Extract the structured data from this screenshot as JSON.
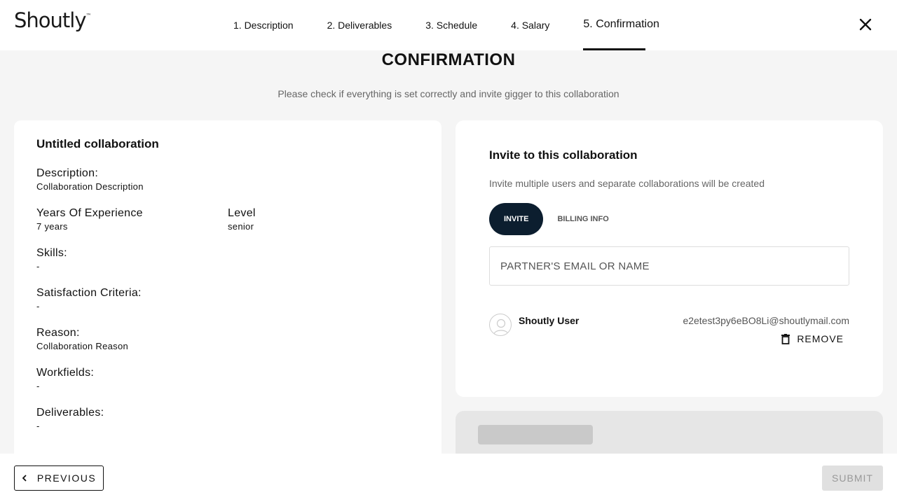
{
  "app": {
    "logo": "Shoutly"
  },
  "steps": [
    {
      "label": "1. Description"
    },
    {
      "label": "2. Deliverables"
    },
    {
      "label": "3. Schedule"
    },
    {
      "label": "4. Salary"
    },
    {
      "label": "5. Confirmation",
      "active": true
    }
  ],
  "page": {
    "title": "CONFIRMATION",
    "subtitle": "Please check if everything is set correctly and invite gigger to this collaboration"
  },
  "summary": {
    "title": "Untitled collaboration",
    "description_label": "Description:",
    "description_value": "Collaboration Description",
    "experience_label": "Years Of Experience",
    "experience_value": "7 years",
    "level_label": "Level",
    "level_value": "senior",
    "skills_label": "Skills:",
    "skills_value": "-",
    "criteria_label": "Satisfaction Criteria:",
    "criteria_value": "-",
    "reason_label": "Reason:",
    "reason_value": "Collaboration Reason",
    "workfields_label": "Workfields:",
    "workfields_value": "-",
    "deliverables_label": "Deliverables:",
    "deliverables_value": "-"
  },
  "invite": {
    "title": "Invite to this collaboration",
    "subtitle": "Invite multiple users and separate collaborations will be created",
    "tab_invite": "INVITE",
    "tab_billing": "BILLING INFO",
    "search_placeholder": "PARTNER'S EMAIL OR NAME",
    "user_name": "Shoutly User",
    "user_email": "e2etest3py6eBO8Li@shoutlymail.com",
    "remove_label": "REMOVE"
  },
  "footer": {
    "previous_label": "PREVIOUS",
    "submit_label": "SUBMIT"
  },
  "colors": {
    "accent": "#0c1e2f",
    "background": "#f5f5f5"
  }
}
